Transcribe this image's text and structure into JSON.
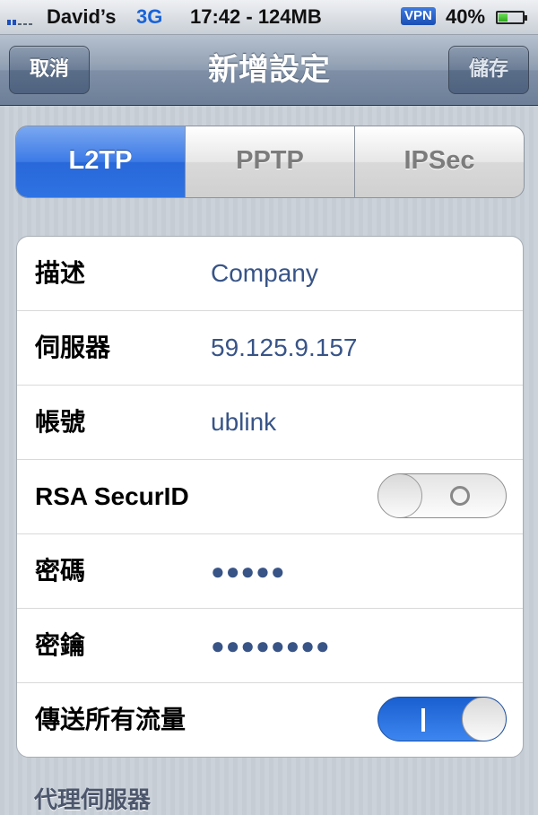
{
  "status_bar": {
    "carrier": "David’s",
    "network": "3G",
    "time_memory": "17:42 - 124MB",
    "vpn_badge": "VPN",
    "battery_percent": "40%",
    "battery_level": 0.4
  },
  "nav": {
    "title": "新增設定",
    "cancel_label": "取消",
    "save_label": "儲存"
  },
  "tabs": [
    {
      "label": "L2TP",
      "active": true
    },
    {
      "label": "PPTP",
      "active": false
    },
    {
      "label": "IPSec",
      "active": false
    }
  ],
  "settings": {
    "description": {
      "label": "描述",
      "value": "Company"
    },
    "server": {
      "label": "伺服器",
      "value": "59.125.9.157"
    },
    "account": {
      "label": "帳號",
      "value": "ublink"
    },
    "rsa": {
      "label": "RSA SecurID",
      "on": false
    },
    "password": {
      "label": "密碼",
      "value": "●●●●●"
    },
    "secret": {
      "label": "密鑰",
      "value": "●●●●●●●●"
    },
    "send_all_traffic": {
      "label": "傳送所有流量",
      "on": true
    }
  },
  "proxy_section": {
    "header": "代理伺服器"
  },
  "colors": {
    "accent_blue": "#2f72e2",
    "value_text": "#385487",
    "nav_bar": "#6d7f98"
  }
}
